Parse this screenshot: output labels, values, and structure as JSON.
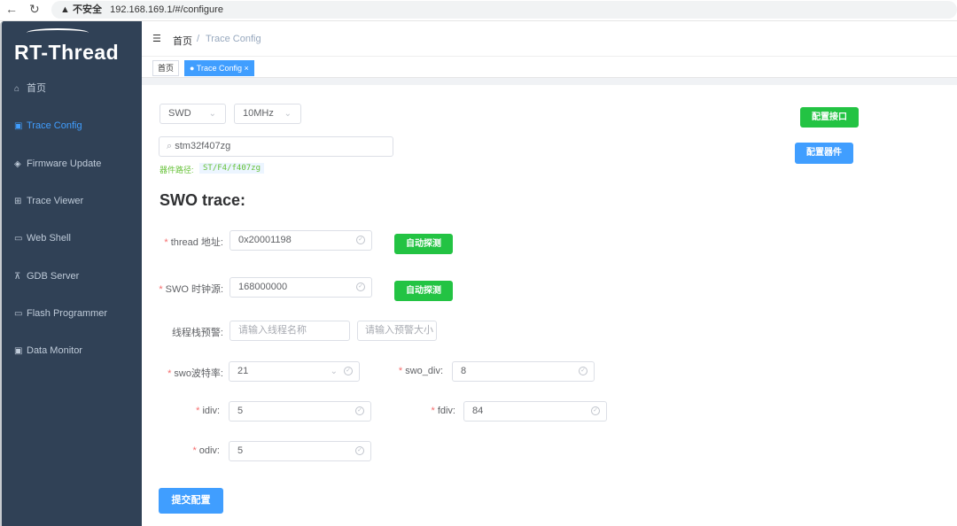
{
  "browser": {
    "security_label": "不安全",
    "url": "192.168.169.1/#/configure"
  },
  "sidebar": {
    "logo": "RT-Thread",
    "items": [
      {
        "label": "首页",
        "icon": "home-icon"
      },
      {
        "label": "Trace Config",
        "icon": "monitor-icon",
        "active": true
      },
      {
        "label": "Firmware Update",
        "icon": "shield-icon"
      },
      {
        "label": "Trace Viewer",
        "icon": "grid-icon"
      },
      {
        "label": "Web Shell",
        "icon": "terminal-icon"
      },
      {
        "label": "GDB Server",
        "icon": "network-icon"
      },
      {
        "label": "Flash Programmer",
        "icon": "screen-icon"
      },
      {
        "label": "Data Monitor",
        "icon": "data-icon"
      }
    ]
  },
  "header": {
    "breadcrumb_home": "首页",
    "breadcrumb_sep": "/",
    "breadcrumb_current": "Trace Config"
  },
  "tags": [
    {
      "label": "首页"
    },
    {
      "label": "Trace Config",
      "active": true
    }
  ],
  "config": {
    "interface": "SWD",
    "speed": "10MHz",
    "device_search": "stm32f407zg",
    "device_path_label": "器件路径:",
    "device_path": "ST/F4/f407zg",
    "btn_config_interface": "配置接口",
    "btn_config_device": "配置器件"
  },
  "swo": {
    "title": "SWO trace:",
    "thread_addr_label": "thread 地址:",
    "thread_addr": "0x20001198",
    "auto_detect": "自动探测",
    "clock_label": "SWO 时钟源:",
    "clock": "168000000",
    "stack_warn_label": "线程栈预警:",
    "thread_name_placeholder": "请输入线程名称",
    "warn_size_placeholder": "请输入预警大小",
    "baud_label": "swo波特率:",
    "baud": "21",
    "swo_div_label": "swo_div:",
    "swo_div": "8",
    "idiv_label": "idiv:",
    "idiv": "5",
    "fdiv_label": "fdiv:",
    "fdiv": "84",
    "odiv_label": "odiv:",
    "odiv": "5",
    "submit": "提交配置"
  },
  "colors": {
    "sidebar_bg": "#304156",
    "accent": "#409eff",
    "success": "#23c343"
  }
}
